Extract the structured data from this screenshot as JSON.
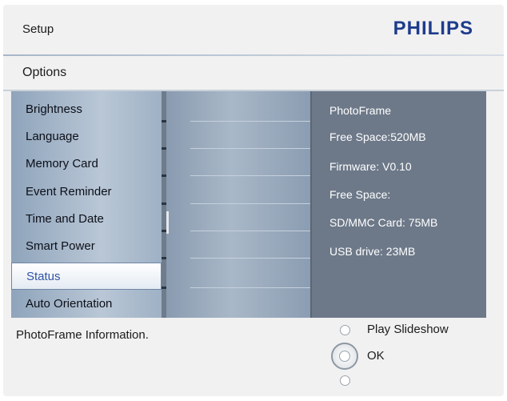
{
  "header": {
    "title": "Setup",
    "brand": "PHILIPS"
  },
  "options": {
    "title": "Options"
  },
  "menu": {
    "items": [
      {
        "label": "Brightness"
      },
      {
        "label": "Language"
      },
      {
        "label": "Memory Card"
      },
      {
        "label": "Event Reminder"
      },
      {
        "label": "Time and Date"
      },
      {
        "label": "Smart Power"
      },
      {
        "label": "Status",
        "selected": true
      },
      {
        "label": "Auto Orientation"
      }
    ]
  },
  "info": {
    "lines": [
      "PhotoFrame",
      "Free Space:520MB",
      "Firmware: V0.10",
      "Free Space:",
      "SD/MMC Card: 75MB",
      "USB drive: 23MB"
    ]
  },
  "footer": {
    "status_text": "PhotoFrame Information.",
    "play_slideshow_label": "Play Slideshow",
    "ok_label": "OK"
  },
  "colors": {
    "brand": "#1e3c8c",
    "selected_text": "#2f54a4",
    "panel": "#6d7989"
  }
}
